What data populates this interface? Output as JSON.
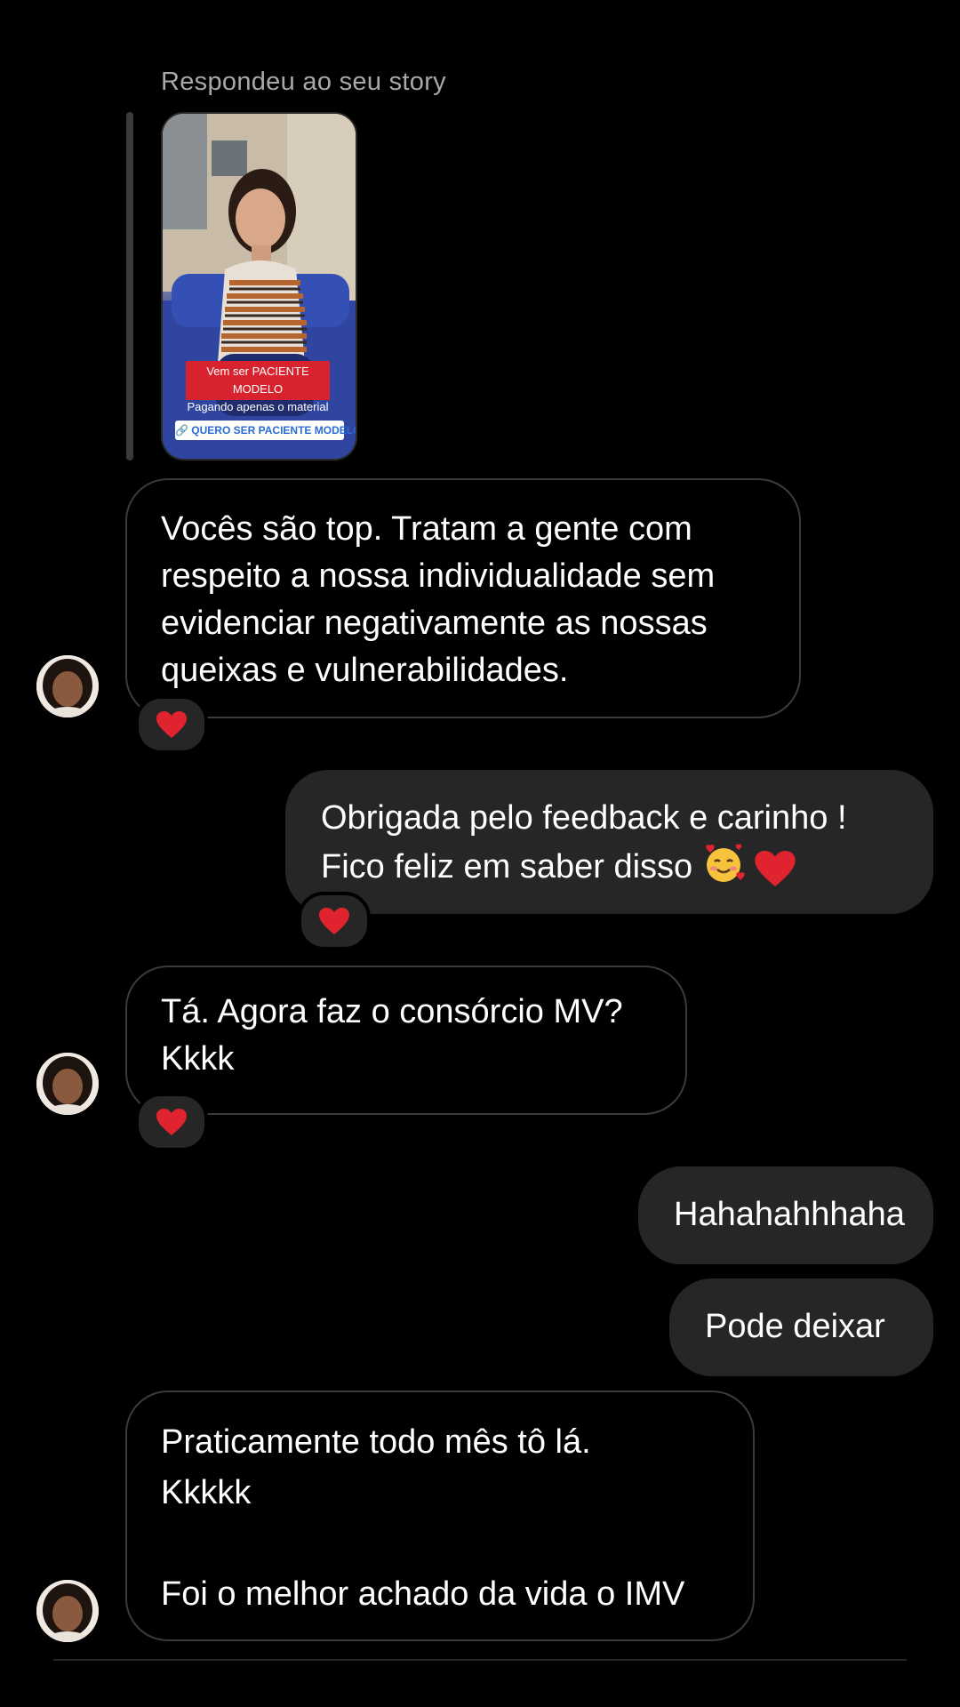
{
  "story": {
    "caption": "Respondeu ao seu story",
    "banner_line1": "Vem ser PACIENTE MODELO",
    "banner_line2": "Pagando apenas o material",
    "link_text": "🔗 QUERO SER PACIENTE MODELO"
  },
  "messages": [
    {
      "direction": "received",
      "lines": [
        "Vocês são top. Tratam a gente com",
        "respeito a nossa individualidade sem",
        "evidenciar negativamente as nossas",
        "queixas e vulnerabilidades."
      ],
      "reaction": "heart"
    },
    {
      "direction": "sent",
      "lines": [
        "Obrigada pelo feedback e carinho !",
        "Fico feliz em saber disso"
      ],
      "reaction": "heart"
    },
    {
      "direction": "received",
      "lines": [
        "Tá. Agora faz o consórcio MV?",
        "Kkkk"
      ],
      "reaction": "heart"
    },
    {
      "direction": "sent",
      "lines": [
        "Hahahahhhaha"
      ]
    },
    {
      "direction": "sent",
      "lines": [
        "Pode deixar"
      ]
    },
    {
      "direction": "received",
      "lines": [
        "Praticamente todo mês tô lá.",
        "Kkkkk",
        "",
        "Foi o melhor achado da vida o IMV"
      ]
    }
  ],
  "colors": {
    "background": "#000000",
    "sent_bubble": "#262626",
    "received_border": "#3b3b3b",
    "heart": "#e0242f",
    "caption": "#a8a8a8"
  },
  "icons": {
    "reaction": "red-heart-icon",
    "avatar": "contact-avatar",
    "emoji": "smiling-face-with-hearts-emoji"
  }
}
